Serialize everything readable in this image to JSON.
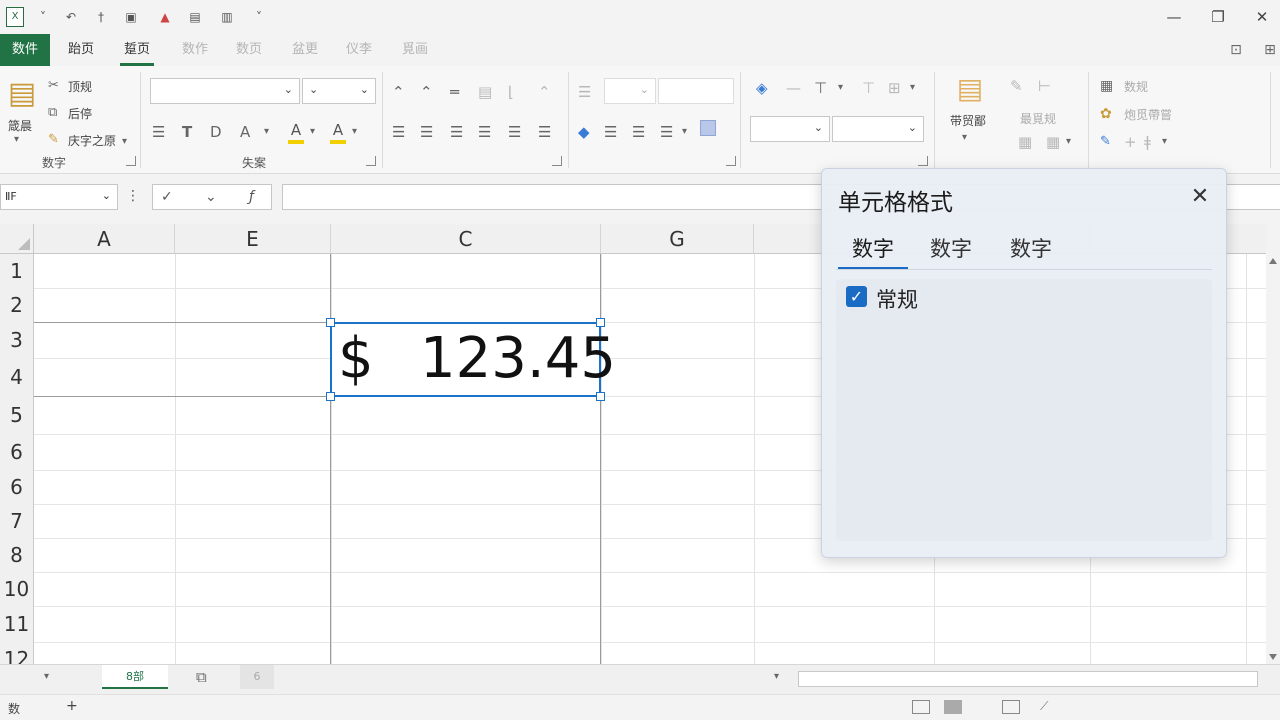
{
  "title_bar": {
    "app_icon": "excel-app-icon",
    "quick_access_icons": [
      "undo-icon",
      "pin-icon",
      "save-icon",
      "picture-icon",
      "print-icon",
      "chart-icon",
      "customize-dropdown-icon"
    ],
    "window_controls": [
      "minimize-icon",
      "restore-icon",
      "close-icon"
    ]
  },
  "ribbon_tabs": {
    "file": "数件",
    "tabs": [
      {
        "label": "跆页",
        "state": "normal"
      },
      {
        "label": "踅页",
        "state": "active"
      },
      {
        "label": "数作",
        "state": "faded"
      },
      {
        "label": "数页",
        "state": "faded"
      },
      {
        "label": "盆更",
        "state": "faded"
      },
      {
        "label": "仪李",
        "state": "faded"
      },
      {
        "label": "覓画",
        "state": "faded"
      }
    ],
    "right_icons": [
      "comments-icon",
      "collapse-ribbon-icon"
    ]
  },
  "ribbon": {
    "clipboard": {
      "paste_label": "箴晨",
      "items": [
        "顶规",
        "后停",
        "庆字之原"
      ],
      "caption": "数字"
    },
    "font": {
      "name_value": "",
      "size_value": "",
      "caption": "失案"
    },
    "right_groups": {
      "styles_label": "带贸鄙",
      "cells_label": "最覓规",
      "editing_items": [
        "数规",
        "炮觅帶嘗"
      ]
    }
  },
  "formula_bar": {
    "name_box": "ⅡF",
    "fx_symbol": "ƒ",
    "formula_value": ""
  },
  "grid": {
    "columns": [
      "A",
      "E",
      "C",
      "G"
    ],
    "rows": [
      "1",
      "2",
      "3",
      "4",
      "5",
      "6",
      "6",
      "7",
      "8",
      "10",
      "11",
      "12"
    ],
    "selected_cell": {
      "currency_symbol": "$",
      "value": "123.45"
    }
  },
  "sheet_tabs": {
    "active_sheet": "8部",
    "other_tab": "6"
  },
  "status_bar": {
    "left_text": "数"
  },
  "format_cells_dialog": {
    "title": "单元格格式",
    "tabs": [
      "数字",
      "数字",
      "数字"
    ],
    "active_tab_index": 0,
    "checkbox_label": "常规",
    "checkbox_checked": true
  },
  "colors": {
    "accent_green": "#217346",
    "selection_blue": "#1a73c8",
    "dialog_tab_blue": "#1a6bc4"
  }
}
